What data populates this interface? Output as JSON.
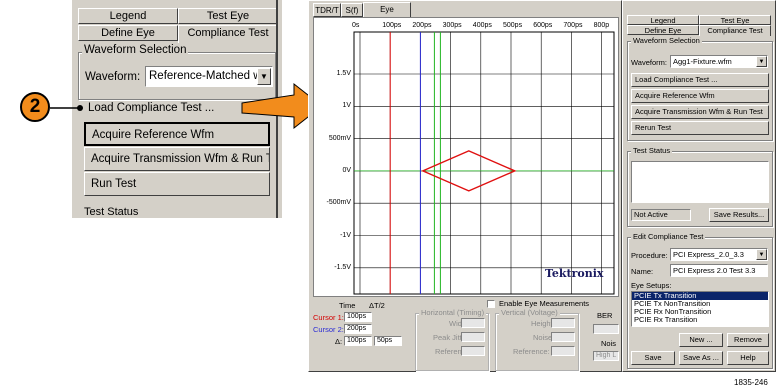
{
  "zoomed_panel": {
    "tabs": [
      "Legend",
      "Test Eye",
      "Define Eye",
      "Compliance Test"
    ],
    "group_title": "Waveform Selection",
    "waveform_label": "Waveform:",
    "waveform_value": "Reference-Matched wf",
    "load_link": "Load Compliance Test ...",
    "buttons": [
      "Acquire Reference Wfm",
      "Acquire Transmission Wfm & Run Test",
      "Run Test"
    ],
    "status_group": "Test Status"
  },
  "callout": {
    "number": "2",
    "color": "#f28c1c"
  },
  "main_window": {
    "tabs": [
      "TDR/T",
      "S(f)",
      "Eye Diagram"
    ],
    "x_ticks": [
      "0s",
      "100ps",
      "200ps",
      "300ps",
      "400ps",
      "500ps",
      "600ps",
      "700ps",
      "800p"
    ],
    "y_ticks": [
      "1.5V",
      "1V",
      "500mV",
      "0V",
      "-500mV",
      "-1V",
      "-1.5V"
    ],
    "brand": "Tektronix",
    "cursor_colors": {
      "cursor1": "#d40000",
      "cursor2": "#2b2bd4",
      "markers": "#22b422",
      "mask": "#e01010"
    }
  },
  "bottom_panel": {
    "time_header": "Time",
    "delta_header": "ΔT/2",
    "cursor1_label": "Cursor 1:",
    "cursor1_value": "100ps",
    "cursor2_label": "Cursor 2:",
    "cursor2_value": "200ps",
    "delta_label": "Δ:",
    "delta_value": "100ps",
    "half_delta_value": "50ps",
    "enable_eye": "Enable Eye Measurements",
    "horizontal_group": "Horizontal (Timing)",
    "h_fields": [
      "Width:",
      "Peak Jitter:",
      "Reference:"
    ],
    "vertical_group": "Vertical (Voltage)",
    "v_fields": [
      "Height:",
      "Noise:",
      "Reference:"
    ],
    "ber": "BER",
    "noise_short": "Nois",
    "high_short": "High L"
  },
  "right_panel": {
    "tabs": [
      "Legend",
      "Test Eye",
      "Define Eye",
      "Compliance Test"
    ],
    "group_title": "Waveform Selection",
    "waveform_label": "Waveform:",
    "waveform_value": "Agg1-Fixture.wfm",
    "buttons": [
      "Load Compliance Test ...",
      "Acquire Reference Wfm",
      "Acquire Transmission Wfm & Run Test",
      "Rerun Test"
    ],
    "status_group": "Test Status",
    "status_value": "Not Active",
    "save_results": "Save Results...",
    "edit_group": "Edit Compliance Test",
    "procedure_label": "Procedure:",
    "procedure_value": "PCI Express_2.0_3.3",
    "name_label": "Name:",
    "name_value": "PCI Express 2.0 Test 3.3",
    "eye_setups_label": "Eye Setups:",
    "eye_setups": [
      "PCIE Tx Transition",
      "PCIE Tx NonTransition",
      "PCIE Rx NonTransition",
      "PCIE Rx Transition"
    ],
    "new_button": "New ...",
    "remove_button": "Remove",
    "save_button": "Save",
    "save_as_button": "Save As ...",
    "help_button": "Help"
  },
  "figure_number": "1835-246"
}
